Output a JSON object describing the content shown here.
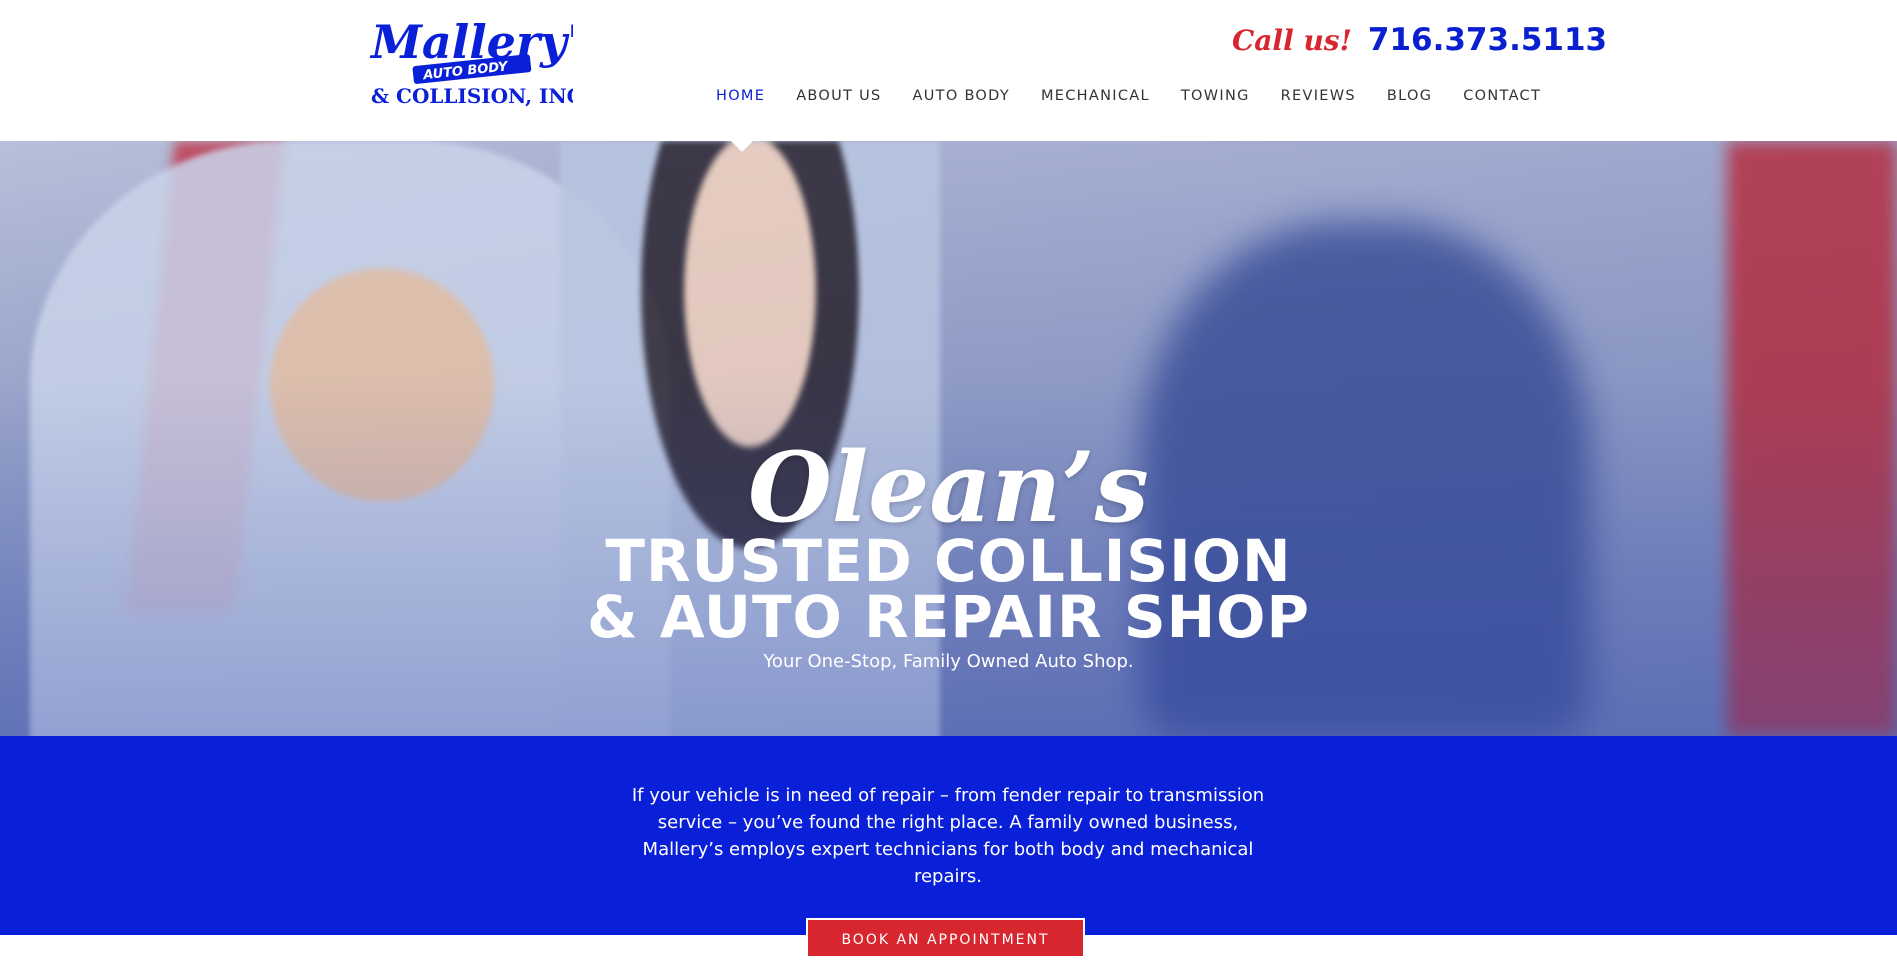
{
  "header": {
    "logo": {
      "line1": "Mallery's",
      "line2": "AUTO BODY",
      "line3": "& COLLISION, INC."
    },
    "call_label": "Call us!",
    "phone": "716.373.5113",
    "nav": [
      {
        "label": "HOME",
        "active": true
      },
      {
        "label": "ABOUT US",
        "active": false
      },
      {
        "label": "AUTO BODY",
        "active": false
      },
      {
        "label": "MECHANICAL",
        "active": false
      },
      {
        "label": "TOWING",
        "active": false
      },
      {
        "label": "REVIEWS",
        "active": false
      },
      {
        "label": "BLOG",
        "active": false
      },
      {
        "label": "CONTACT",
        "active": false
      }
    ]
  },
  "hero": {
    "script": "Olean’s",
    "line1": "TRUSTED COLLISION",
    "line2": "& AUTO REPAIR SHOP",
    "subtitle": "Your One-Stop, Family Owned Auto Shop."
  },
  "intro": {
    "text": "If your vehicle is in need of repair – from fender repair to transmission service – you’ve found the right place. A family owned business, Mallery’s employs expert technicians for both body and mechanical repairs.",
    "cta": "BOOK AN APPOINTMENT"
  },
  "colors": {
    "brand_blue": "#0a1fd8",
    "accent_red": "#d8262f"
  }
}
